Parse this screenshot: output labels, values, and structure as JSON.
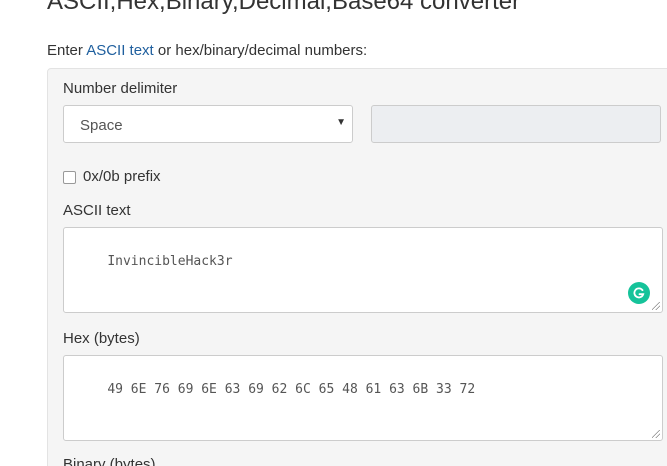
{
  "title": "ASCII,Hex,Binary,Decimal,Base64 converter",
  "intro": {
    "prefix": "Enter ",
    "link": "ASCII text",
    "suffix": " or hex/binary/decimal numbers:"
  },
  "delimiter": {
    "label": "Number delimiter",
    "selected": "Space",
    "custom_value": ""
  },
  "prefix_option": {
    "label": "0x/0b prefix",
    "checked": false
  },
  "ascii": {
    "label": "ASCII text",
    "value": "InvincibleHack3r"
  },
  "hex": {
    "label": "Hex (bytes)",
    "value": "49 6E 76 69 6E 63 69 62 6C 65 48 61 63 6B 33 72"
  },
  "binary": {
    "label": "Binary (bytes)"
  },
  "colors": {
    "link": "#1f5f9e",
    "panel_bg": "#f5f5f5",
    "grammarly": "#15c39a"
  }
}
